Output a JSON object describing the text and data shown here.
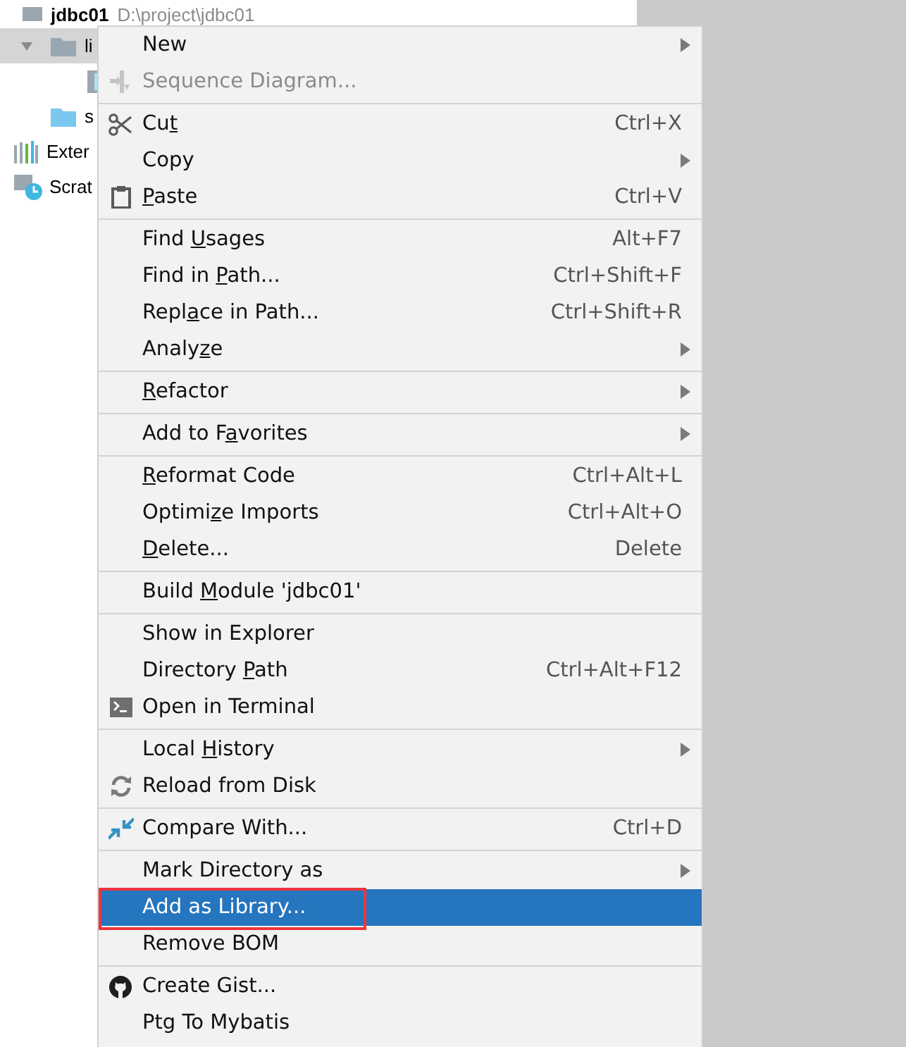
{
  "tree": {
    "root": {
      "name": "jdbc01",
      "path": "D:\\project\\jdbc01"
    },
    "items": [
      {
        "name": "li",
        "kind": "folder",
        "selected": true,
        "expanded": true
      },
      {
        "kind": "file",
        "selected": false
      },
      {
        "name": "s",
        "kind": "source",
        "selected": false
      },
      {
        "name": "Exter",
        "kind": "libraries",
        "selected": false
      },
      {
        "name": "Scrat",
        "kind": "scratches",
        "selected": false
      }
    ]
  },
  "menu": {
    "groups": [
      [
        {
          "text": "New",
          "submenu": true,
          "disabled": false,
          "selected": false
        },
        {
          "text": "Sequence Diagram...",
          "kind": "sequence",
          "submenu": false,
          "disabled": true,
          "selected": false
        }
      ],
      [
        {
          "text": "Cu",
          "key": "t",
          "kind": "cut",
          "shortcut": "Ctrl+X",
          "submenu": false,
          "disabled": false,
          "selected": false
        },
        {
          "text": "Copy",
          "submenu": true,
          "disabled": false,
          "selected": false
        },
        {
          "key": "P",
          "rest": "aste",
          "kind": "paste",
          "shortcut": "Ctrl+V",
          "submenu": false,
          "disabled": false,
          "selected": false
        }
      ],
      [
        {
          "text": "Find ",
          "key": "U",
          "rest": "sages",
          "shortcut": "Alt+F7",
          "submenu": false,
          "disabled": false,
          "selected": false
        },
        {
          "text": "Find in ",
          "key": "P",
          "rest": "ath...",
          "shortcut": "Ctrl+Shift+F",
          "submenu": false,
          "disabled": false,
          "selected": false
        },
        {
          "text": "Repl",
          "key": "a",
          "rest": "ce in Path...",
          "shortcut": "Ctrl+Shift+R",
          "submenu": false,
          "disabled": false,
          "selected": false
        },
        {
          "text": "Analy",
          "key": "z",
          "rest": "e",
          "submenu": true,
          "disabled": false,
          "selected": false
        }
      ],
      [
        {
          "key": "R",
          "rest": "efactor",
          "submenu": true,
          "disabled": false,
          "selected": false
        }
      ],
      [
        {
          "text": "Add to F",
          "key": "a",
          "rest": "vorites",
          "submenu": true,
          "disabled": false,
          "selected": false
        }
      ],
      [
        {
          "key": "R",
          "rest": "eformat Code",
          "shortcut": "Ctrl+Alt+L",
          "submenu": false,
          "disabled": false,
          "selected": false
        },
        {
          "text": "Optimi",
          "key": "z",
          "rest": "e Imports",
          "shortcut": "Ctrl+Alt+O",
          "submenu": false,
          "disabled": false,
          "selected": false
        },
        {
          "key": "D",
          "rest": "elete...",
          "shortcut": "Delete",
          "submenu": false,
          "disabled": false,
          "selected": false
        }
      ],
      [
        {
          "text": "Build ",
          "key": "M",
          "rest": "odule 'jdbc01'",
          "submenu": false,
          "disabled": false,
          "selected": false
        }
      ],
      [
        {
          "text": "Show in Explorer",
          "submenu": false,
          "disabled": false,
          "selected": false
        },
        {
          "text": "Directory ",
          "key": "P",
          "rest": "ath",
          "shortcut": "Ctrl+Alt+F12",
          "submenu": false,
          "disabled": false,
          "selected": false
        },
        {
          "text": "Open in Terminal",
          "kind": "terminal",
          "submenu": false,
          "disabled": false,
          "selected": false
        }
      ],
      [
        {
          "text": "Local ",
          "key": "H",
          "rest": "istory",
          "submenu": true,
          "disabled": false,
          "selected": false
        },
        {
          "text": "Reload from Disk",
          "kind": "reload",
          "submenu": false,
          "disabled": false,
          "selected": false
        }
      ],
      [
        {
          "text": "Compare With...",
          "kind": "compare",
          "shortcut": "Ctrl+D",
          "submenu": false,
          "disabled": false,
          "selected": false
        }
      ],
      [
        {
          "text": "Mark Directory as",
          "submenu": true,
          "disabled": false,
          "selected": false
        },
        {
          "text": "Add as Library...",
          "submenu": false,
          "disabled": false,
          "selected": true
        },
        {
          "text": "Remove BOM",
          "submenu": false,
          "disabled": false,
          "selected": false
        }
      ],
      [
        {
          "text": "Create Gist...",
          "kind": "gist",
          "submenu": false,
          "disabled": false,
          "selected": false
        },
        {
          "text": "Ptg To Mybatis",
          "submenu": false,
          "disabled": false,
          "selected": false
        }
      ]
    ]
  },
  "annotation": {
    "kind": "frame"
  }
}
